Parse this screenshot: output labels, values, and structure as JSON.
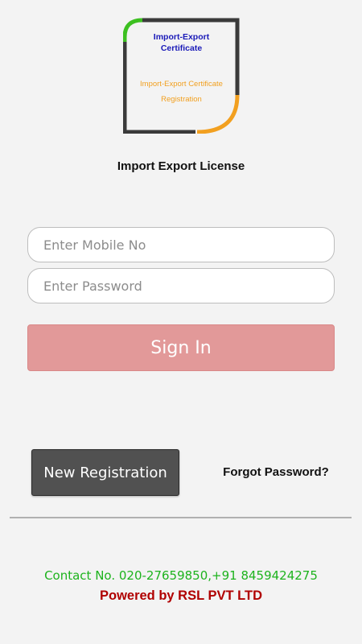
{
  "logo": {
    "line1": "Import-Export",
    "line2": "Certificate",
    "line3": "Import-Export Certificate",
    "line4": "Registration"
  },
  "app_title": "Import Export License",
  "form": {
    "mobile_placeholder": "Enter Mobile No",
    "mobile_value": "",
    "password_placeholder": "Enter Password",
    "password_value": "",
    "sign_in_label": "Sign In"
  },
  "actions": {
    "new_registration_label": "New Registration",
    "forgot_password_label": "Forgot Password?"
  },
  "footer": {
    "contact": "Contact No. 020-27659850,+91 8459424275",
    "powered_by": "Powered by RSL PVT LTD"
  },
  "colors": {
    "background": "#f3f3f3",
    "sign_in_button": "#e29999",
    "new_registration_button": "#515151",
    "contact_text": "#1db31d",
    "powered_text": "#b00000",
    "logo_blue": "#1a1ab8",
    "logo_orange": "#f2a020",
    "logo_green": "#3cc020"
  }
}
